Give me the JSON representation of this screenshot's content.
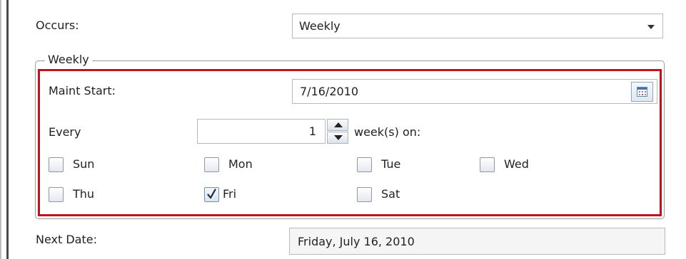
{
  "occurs": {
    "label": "Occurs:",
    "value": "Weekly"
  },
  "group": {
    "legend": "Weekly"
  },
  "maint_start": {
    "label": "Maint Start:",
    "value": "7/16/2010",
    "icon": "calendar-icon"
  },
  "every": {
    "label": "Every",
    "value": "1",
    "suffix": "week(s) on:"
  },
  "days": [
    {
      "label": "Sun",
      "checked": false
    },
    {
      "label": "Mon",
      "checked": false
    },
    {
      "label": "Tue",
      "checked": false
    },
    {
      "label": "Wed",
      "checked": false
    },
    {
      "label": "Thu",
      "checked": false
    },
    {
      "label": "Fri",
      "checked": true
    },
    {
      "label": "Sat",
      "checked": false
    }
  ],
  "next_date": {
    "label": "Next Date:",
    "value": "Friday, July 16, 2010"
  },
  "colors": {
    "highlight_border": "#c0121b",
    "text": "#222222"
  }
}
